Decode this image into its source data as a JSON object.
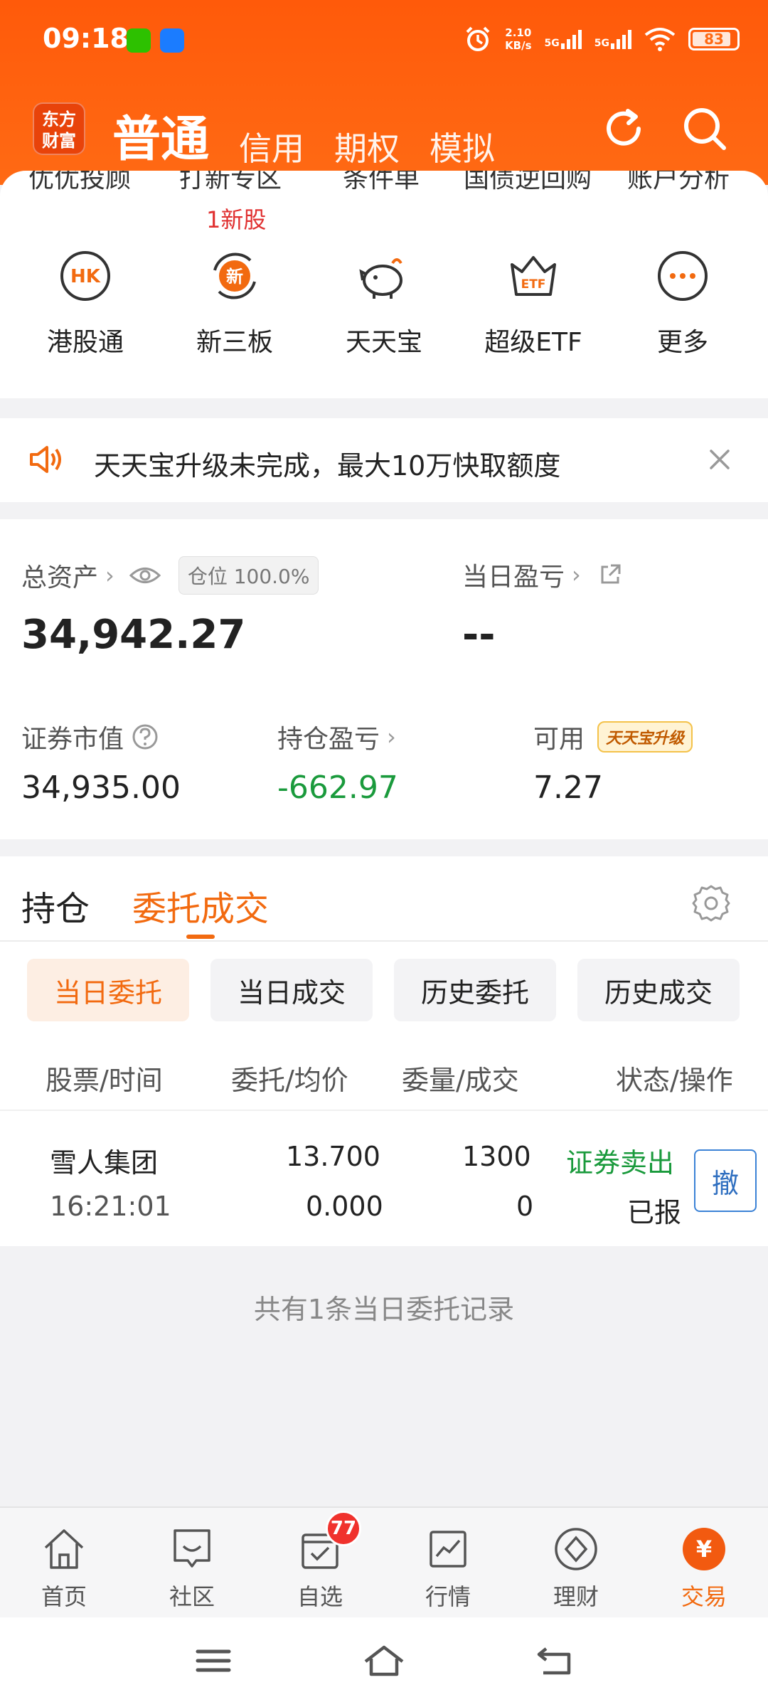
{
  "status_bar": {
    "time": "09:18",
    "net_speed_value": "2.10",
    "net_speed_unit": "KB/s",
    "signal1": "5G",
    "signal2": "5G",
    "battery": "83"
  },
  "top_nav": {
    "logo_line1": "东方",
    "logo_line2": "财富",
    "tabs": [
      "普通",
      "信用",
      "期权",
      "模拟"
    ]
  },
  "quick_row_top": [
    "优优投顾",
    "打新专区",
    "条件单",
    "国债逆回购",
    "账户分析"
  ],
  "new_stock_tag": "1新股",
  "shortcuts": [
    {
      "label": "港股通",
      "icon": "hk-icon",
      "icon_text": "HK"
    },
    {
      "label": "新三板",
      "icon": "new-board-icon",
      "icon_text": "新"
    },
    {
      "label": "天天宝",
      "icon": "piggy-bank-icon"
    },
    {
      "label": "超级ETF",
      "icon": "etf-crown-icon",
      "icon_text": "ETF"
    },
    {
      "label": "更多",
      "icon": "more-icon"
    }
  ],
  "notice": {
    "text": "天天宝升级未完成，最大10万快取额度"
  },
  "assets": {
    "total_label": "总资产",
    "position_badge": "仓位 100.0%",
    "total_value": "34,942.27",
    "daily_pnl_label": "当日盈亏",
    "daily_pnl_value": "--",
    "market_value_label": "证券市值",
    "market_value": "34,935.00",
    "holding_pnl_label": "持仓盈亏",
    "holding_pnl": "-662.97",
    "available_label": "可用",
    "available_badge": "天天宝升级",
    "available": "7.27"
  },
  "orders": {
    "tabs": [
      "持仓",
      "委托成交"
    ],
    "subtabs": [
      "当日委托",
      "当日成交",
      "历史委托",
      "历史成交"
    ],
    "columns": [
      "股票/时间",
      "委托/均价",
      "委量/成交",
      "状态/操作"
    ],
    "rows": [
      {
        "stock": "雪人集团",
        "time": "16:21:01",
        "order_price": "13.700",
        "avg_price": "0.000",
        "order_qty": "1300",
        "filled_qty": "0",
        "direction": "证券卖出",
        "status": "已报",
        "action": "撤"
      }
    ],
    "summary": "共有1条当日委托记录"
  },
  "bottom_nav": [
    {
      "label": "首页",
      "icon": "home-icon"
    },
    {
      "label": "社区",
      "icon": "community-icon"
    },
    {
      "label": "自选",
      "icon": "watchlist-icon",
      "badge": "77"
    },
    {
      "label": "行情",
      "icon": "market-chart-icon"
    },
    {
      "label": "理财",
      "icon": "wealth-icon"
    },
    {
      "label": "交易",
      "icon": "trade-icon",
      "icon_text": "¥"
    }
  ],
  "colors": {
    "brand_orange": "#ff5a0a",
    "accent_orange": "#f26a10",
    "profit_green": "#1a9a3c",
    "link_blue": "#2f6fc0",
    "badge_red": "#f0322d"
  }
}
